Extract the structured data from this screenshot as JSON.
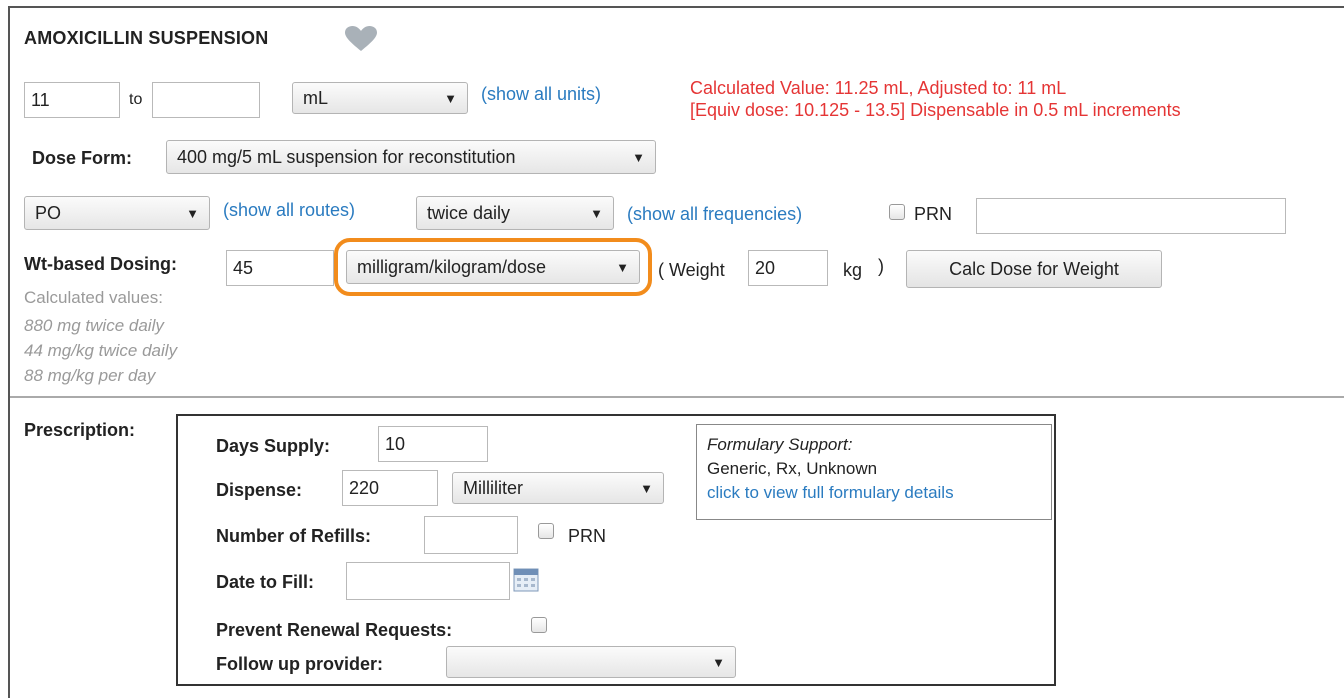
{
  "drug": {
    "name": "AMOXICILLIN SUSPENSION"
  },
  "dose": {
    "from": "11",
    "to_label": "to",
    "to": "",
    "unit": "mL",
    "show_all_units": "(show all units)",
    "calc_line1": "Calculated Value: 11.25 mL, Adjusted to: 11 mL",
    "calc_line2": "[Equiv dose: 10.125 - 13.5] Dispensable in 0.5 mL increments"
  },
  "dose_form": {
    "label": "Dose Form:",
    "value": "400 mg/5 mL suspension for reconstitution"
  },
  "route": {
    "value": "PO",
    "show_all": "(show all routes)"
  },
  "frequency": {
    "value": "twice daily",
    "show_all": "(show all frequencies)"
  },
  "prn": {
    "label": "PRN",
    "text": ""
  },
  "wt_dosing": {
    "label": "Wt-based Dosing:",
    "value": "45",
    "unit": "milligram/kilogram/dose",
    "weight_open": "( Weight",
    "weight": "20",
    "weight_unit": "kg",
    "close_paren": ")",
    "calc_button": "Calc Dose for Weight",
    "calculated_header": "Calculated values:",
    "calculated": [
      "880 mg twice daily",
      "44 mg/kg twice daily",
      "88 mg/kg per day"
    ]
  },
  "prescription": {
    "label": "Prescription:",
    "days_supply_label": "Days Supply:",
    "days_supply": "10",
    "dispense_label": "Dispense:",
    "dispense": "220",
    "dispense_unit": "Milliliter",
    "refills_label": "Number of Refills:",
    "refills": "",
    "refills_prn": "PRN",
    "date_label": "Date to Fill:",
    "date": "",
    "prevent_label": "Prevent Renewal Requests:",
    "followup_label": "Follow up provider:",
    "followup": ""
  },
  "formulary": {
    "title": "Formulary Support:",
    "info": "Generic, Rx, Unknown",
    "link": "click to view full formulary details"
  },
  "colors": {
    "link": "#2a7bc0",
    "warning": "#e53535",
    "highlight": "#f28c1c"
  }
}
